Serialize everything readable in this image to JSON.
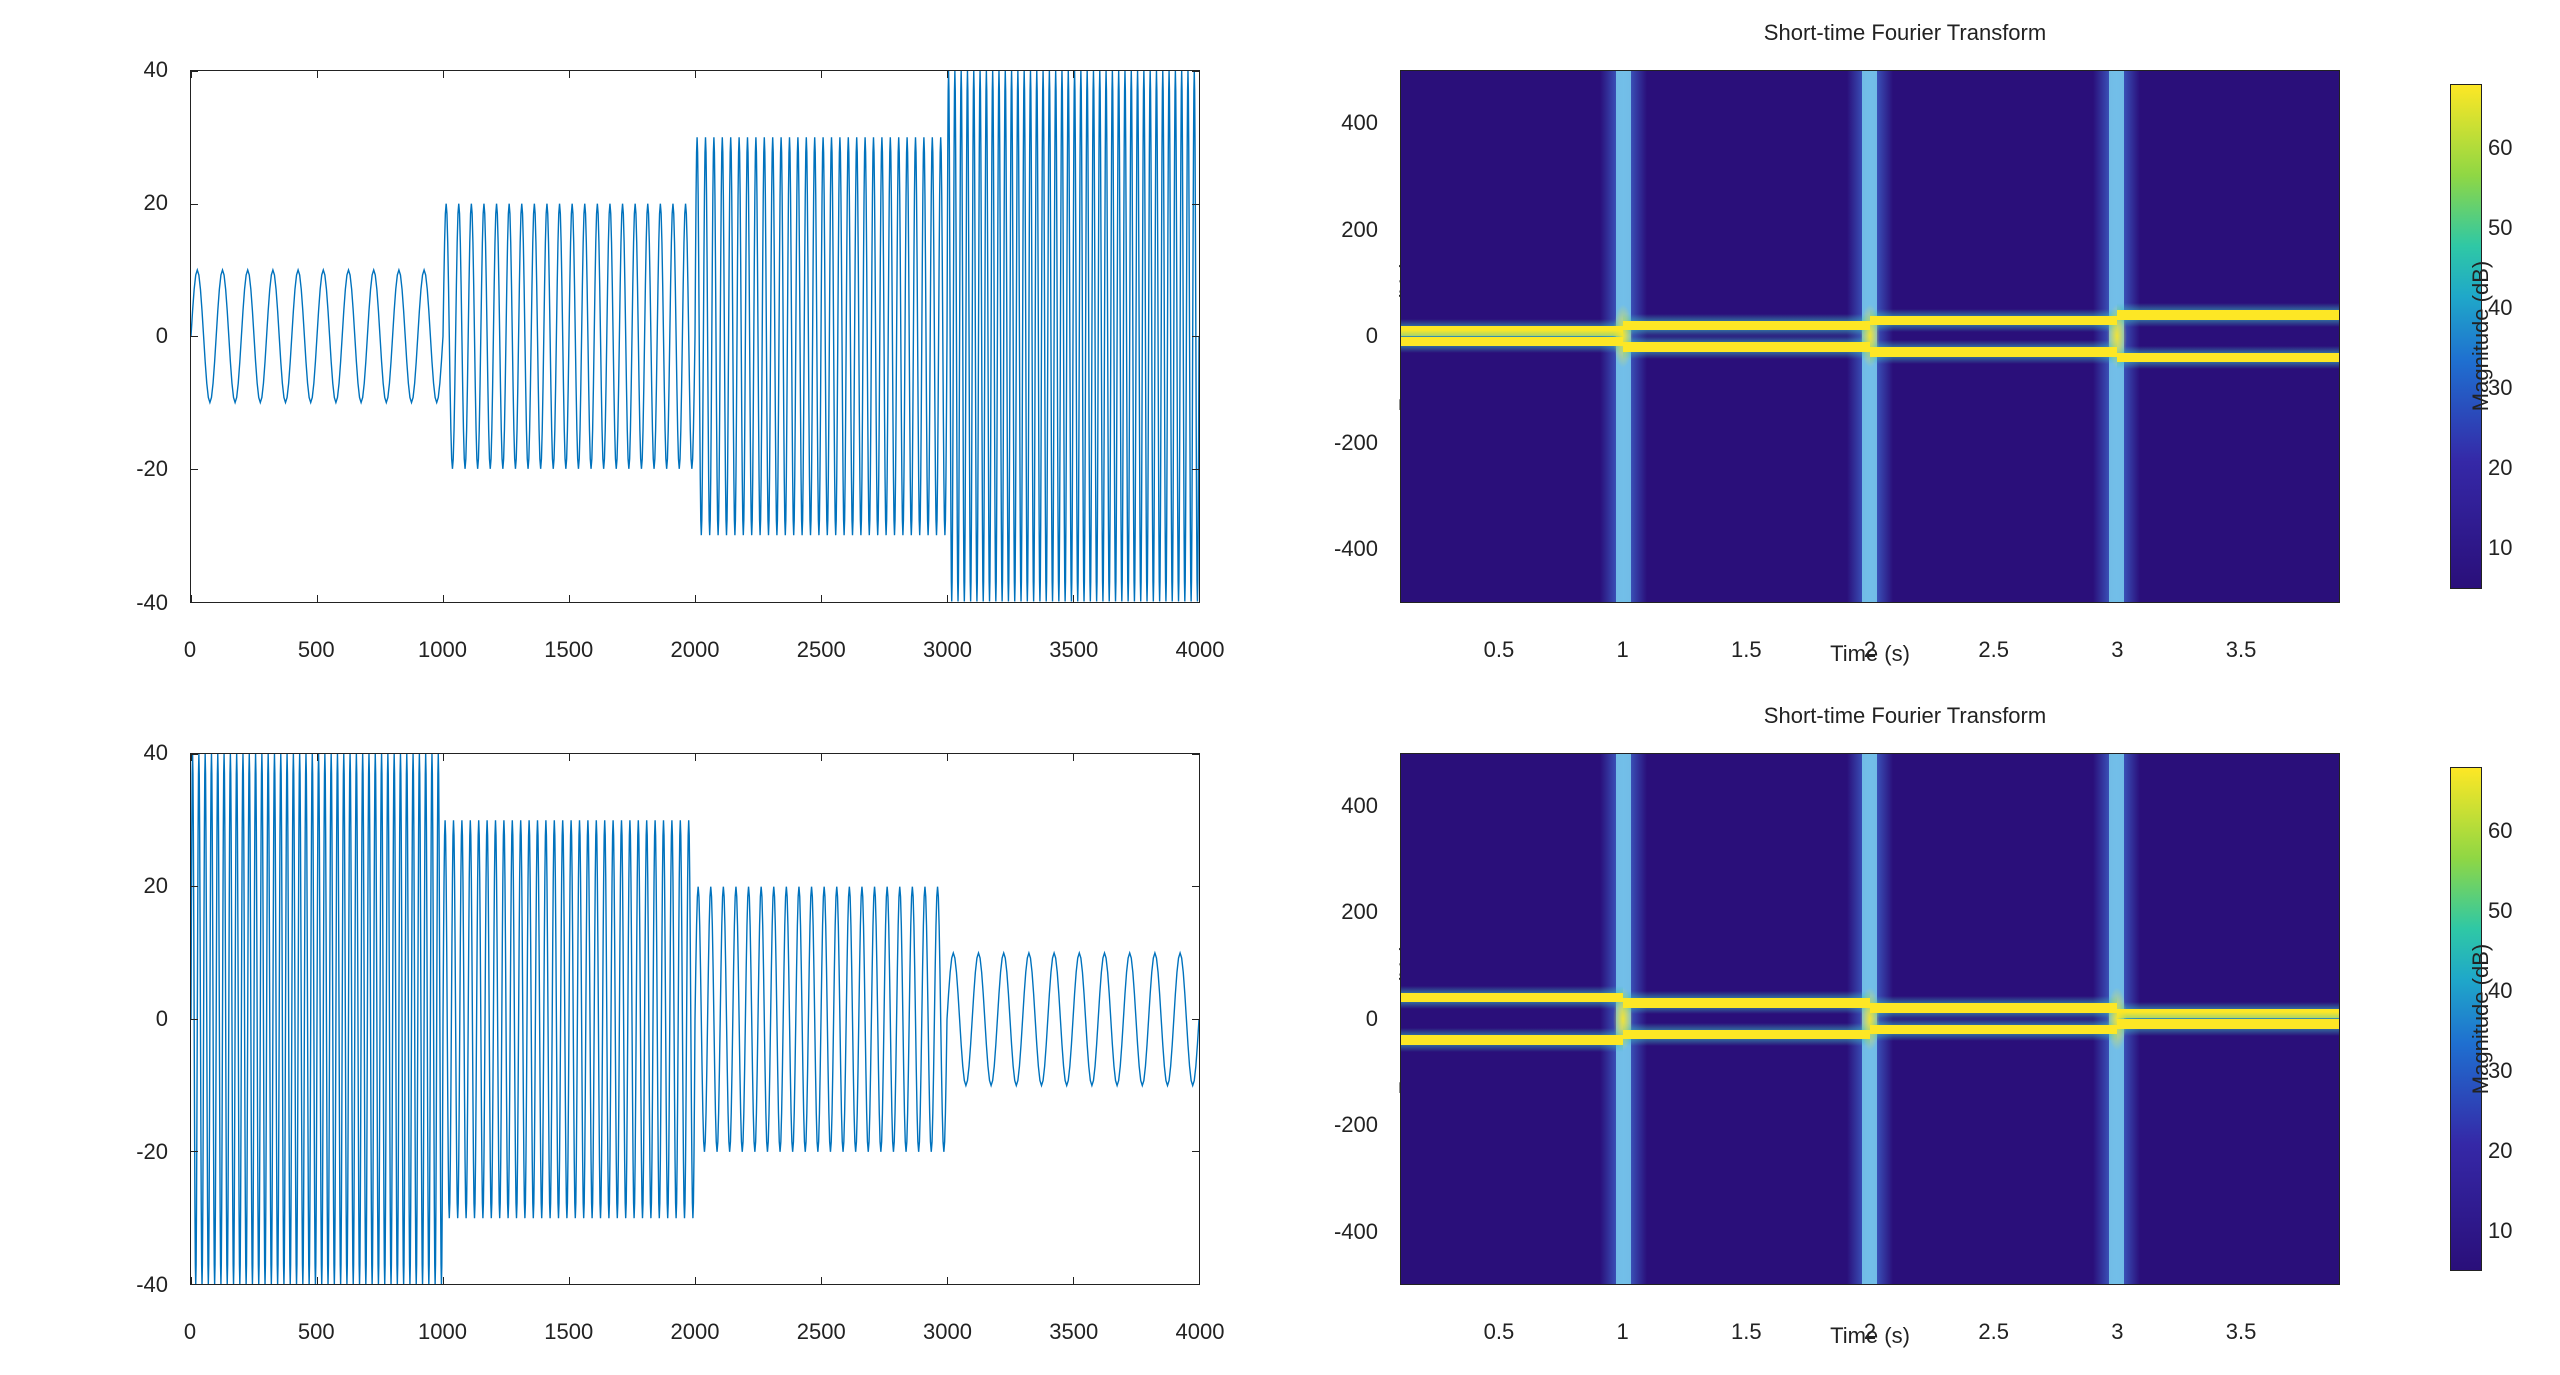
{
  "chart_data": [
    {
      "id": "ts_top",
      "type": "line",
      "title": "",
      "xlabel": "",
      "ylabel": "",
      "xlim": [
        0,
        4000
      ],
      "ylim": [
        -40,
        40
      ],
      "xticks": [
        0,
        500,
        1000,
        1500,
        2000,
        2500,
        3000,
        3500,
        4000
      ],
      "yticks": [
        -40,
        -20,
        0,
        20,
        40
      ],
      "segments": [
        {
          "start": 0,
          "end": 1000,
          "amp": 10,
          "freq_hz": 10
        },
        {
          "start": 1000,
          "end": 2000,
          "amp": 20,
          "freq_hz": 20
        },
        {
          "start": 2000,
          "end": 3000,
          "amp": 30,
          "freq_hz": 30
        },
        {
          "start": 3000,
          "end": 4000,
          "amp": 40,
          "freq_hz": 40
        }
      ],
      "color": "#0072BD"
    },
    {
      "id": "ts_bottom",
      "type": "line",
      "title": "",
      "xlabel": "",
      "ylabel": "",
      "xlim": [
        0,
        4000
      ],
      "ylim": [
        -40,
        40
      ],
      "xticks": [
        0,
        500,
        1000,
        1500,
        2000,
        2500,
        3000,
        3500,
        4000
      ],
      "yticks": [
        -40,
        -20,
        0,
        20,
        40
      ],
      "segments": [
        {
          "start": 0,
          "end": 1000,
          "amp": 40,
          "freq_hz": 40
        },
        {
          "start": 1000,
          "end": 2000,
          "amp": 30,
          "freq_hz": 30
        },
        {
          "start": 2000,
          "end": 3000,
          "amp": 20,
          "freq_hz": 20
        },
        {
          "start": 3000,
          "end": 4000,
          "amp": 10,
          "freq_hz": 10
        }
      ],
      "color": "#0072BD"
    },
    {
      "id": "stft_top",
      "type": "heatmap",
      "title": "Short-time Fourier Transform",
      "xlabel": "Time (s)",
      "ylabel": "Frequency (Hz)",
      "xlim": [
        0.1,
        3.9
      ],
      "ylim": [
        -500,
        500
      ],
      "xticks": [
        0.5,
        1,
        1.5,
        2,
        2.5,
        3,
        3.5
      ],
      "yticks": [
        -400,
        -200,
        0,
        200,
        400
      ],
      "colorbar": {
        "label": "Magnitude (dB)",
        "ticks": [
          10,
          20,
          30,
          40,
          50,
          60
        ],
        "range": [
          5,
          68
        ]
      },
      "transition_times_s": [
        1,
        2,
        3
      ],
      "ridges_hz_by_segment": [
        {
          "t0": 0.1,
          "t1": 1.0,
          "pos_hz": 10,
          "neg_hz": -10
        },
        {
          "t0": 1.0,
          "t1": 2.0,
          "pos_hz": 20,
          "neg_hz": -20
        },
        {
          "t0": 2.0,
          "t1": 3.0,
          "pos_hz": 30,
          "neg_hz": -30
        },
        {
          "t0": 3.0,
          "t1": 3.9,
          "pos_hz": 40,
          "neg_hz": -40
        }
      ]
    },
    {
      "id": "stft_bottom",
      "type": "heatmap",
      "title": "Short-time Fourier Transform",
      "xlabel": "Time (s)",
      "ylabel": "Frequency (Hz)",
      "xlim": [
        0.1,
        3.9
      ],
      "ylim": [
        -500,
        500
      ],
      "xticks": [
        0.5,
        1,
        1.5,
        2,
        2.5,
        3,
        3.5
      ],
      "yticks": [
        -400,
        -200,
        0,
        200,
        400
      ],
      "colorbar": {
        "label": "Magnitude (dB)",
        "ticks": [
          10,
          20,
          30,
          40,
          50,
          60
        ],
        "range": [
          5,
          68
        ]
      },
      "transition_times_s": [
        1,
        2,
        3
      ],
      "ridges_hz_by_segment": [
        {
          "t0": 0.1,
          "t1": 1.0,
          "pos_hz": 40,
          "neg_hz": -40
        },
        {
          "t0": 1.0,
          "t1": 2.0,
          "pos_hz": 30,
          "neg_hz": -30
        },
        {
          "t0": 2.0,
          "t1": 3.0,
          "pos_hz": 20,
          "neg_hz": -20
        },
        {
          "t0": 3.0,
          "t1": 3.9,
          "pos_hz": 10,
          "neg_hz": -10
        }
      ]
    }
  ]
}
